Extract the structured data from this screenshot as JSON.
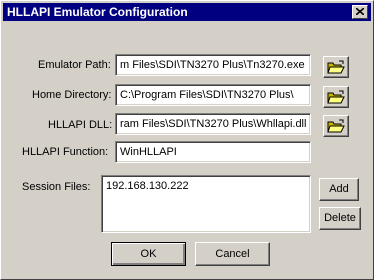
{
  "window": {
    "title": "HLLAPI Emulator Configuration",
    "close_icon": "close-x-icon"
  },
  "form": {
    "emulator_path": {
      "label": "Emulator Path:",
      "value": "m Files\\SDI\\TN3270 Plus\\Tn3270.exe"
    },
    "home_directory": {
      "label": "Home Directory:",
      "value": "C:\\Program Files\\SDI\\TN3270 Plus\\"
    },
    "hllapi_dll": {
      "label": "HLLAPI DLL:",
      "value": "ram Files\\SDI\\TN3270 Plus\\Whllapi.dll"
    },
    "hllapi_function": {
      "label": "HLLAPI Function:",
      "value": "WinHLLAPI"
    },
    "session_files": {
      "label": "Session Files:",
      "items": [
        "192.168.130.222"
      ]
    }
  },
  "buttons": {
    "browse_icon": "open-folder-icon",
    "add": "Add",
    "delete": "Delete",
    "ok": "OK",
    "cancel": "Cancel"
  },
  "colors": {
    "titlebar": "#000080",
    "face": "#d4d0c8"
  }
}
